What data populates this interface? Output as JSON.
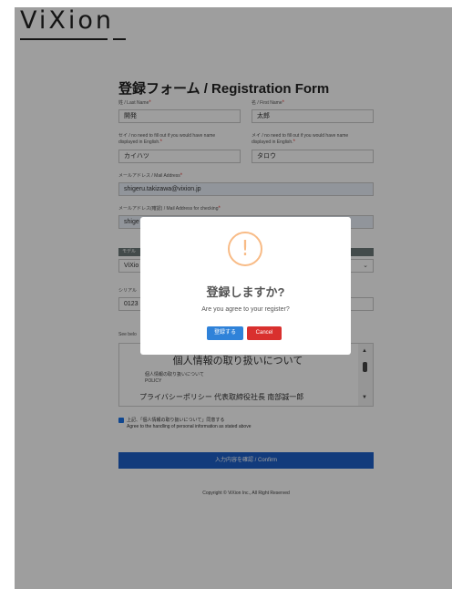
{
  "header": {
    "logo": "ViXion"
  },
  "form": {
    "title": "登録フォーム / Registration Form",
    "last_name": {
      "label": "姓 / Last Name",
      "value": "開発"
    },
    "first_name": {
      "label": "名 / First Name",
      "value": "太郎"
    },
    "last_kana": {
      "label_1": "セイ / no need to fill out if you would have name",
      "label_2": "displayed in English.",
      "value": "カイハツ"
    },
    "first_kana": {
      "label_1": "メイ / no need to fill out if you would have name",
      "label_2": "displayed in English.",
      "value": "タロウ"
    },
    "mail": {
      "label": "メールアドレス / Mail Address",
      "value": "shigeru.takizawa@vixion.jp"
    },
    "mail_confirm": {
      "label": "メールアドレス(確認) / Mail Address for checking",
      "value": "shige"
    },
    "model_section": "モデル",
    "model_value": "ViXio",
    "serial_label": "シリアル",
    "serial_value": "0123",
    "see_below": "See belo",
    "policy": {
      "heading": "個人情報の取り扱いについて",
      "sub_1": "個人情報の取り扱いについて",
      "sub_2": "POLICY",
      "privacy": "プライバシーポリシー 代表取締役社長 南部誠一郎"
    },
    "agree_1": "上記、「個人情報の取り扱いについて」同意する",
    "agree_2": "Agree to the handling of personal information as stated above",
    "confirm_button": "入力内容を確認 / Confirm",
    "copyright": "Copyright © ViXion Inc., All Right Reserved"
  },
  "modal": {
    "icon": "!",
    "title": "登録しますか?",
    "text": "Are you agree to your register?",
    "ok": "登録する",
    "cancel": "Cancel"
  },
  "colors": {
    "confirm": "#1e60c8",
    "ok": "#2f82d9",
    "cancel": "#d9302e",
    "warning": "#f8bb86",
    "required": "#e53935"
  }
}
